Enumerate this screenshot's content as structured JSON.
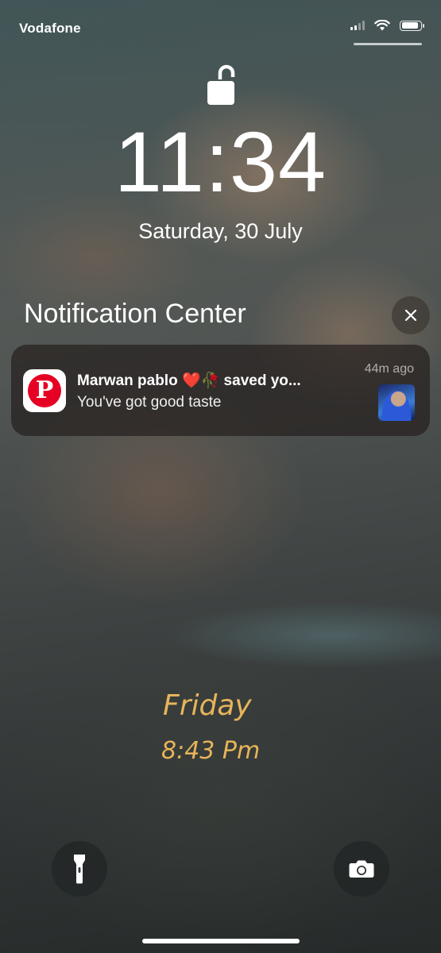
{
  "status_bar": {
    "carrier": "Vodafone",
    "icons": [
      "signal-icon",
      "wifi-icon",
      "battery-icon"
    ],
    "battery_level": 0.9
  },
  "lock_screen": {
    "lock_state_icon": "unlocked-padlock-icon",
    "time": "11:34",
    "date": "Saturday, 30 July"
  },
  "notification_center": {
    "title": "Notification Center",
    "close_icon": "close-icon",
    "notifications": [
      {
        "app_icon": "pinterest-icon",
        "app_icon_letter": "P",
        "title": "Marwan pablo ❤️🥀 saved yo...",
        "body": "You've got good taste",
        "time": "44m ago",
        "thumbnail": "profile-thumbnail"
      }
    ]
  },
  "wallpaper_text": {
    "day": "Friday",
    "time": "8:43 Pm"
  },
  "bottom_controls": {
    "flashlight_icon": "flashlight-icon",
    "camera_icon": "camera-icon"
  },
  "colors": {
    "pinterest_red": "#e60023",
    "wallpaper_text": "#e7b45a"
  }
}
